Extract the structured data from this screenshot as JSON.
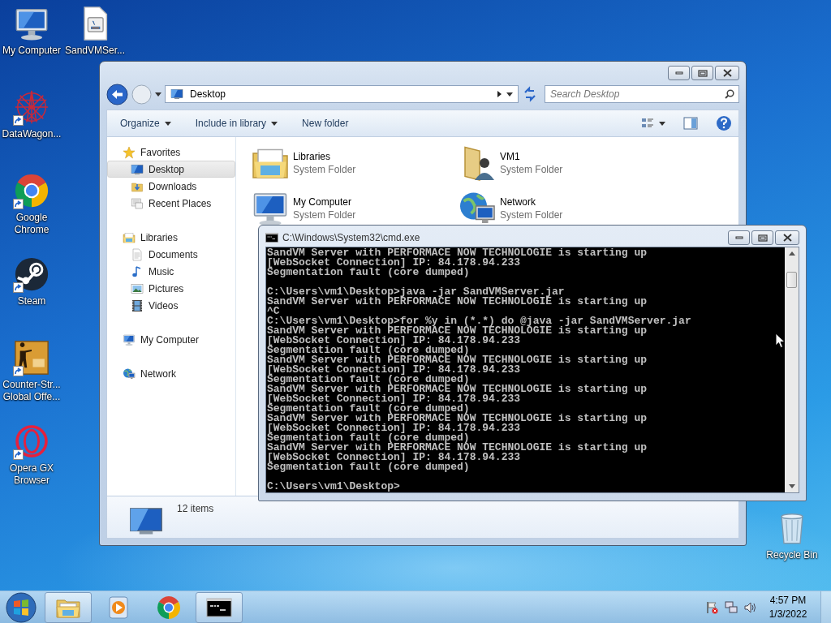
{
  "desktop_icons": [
    {
      "label": "My Computer",
      "kind": "computer",
      "shortcut": false
    },
    {
      "label": "SandVMSer...",
      "kind": "jar",
      "shortcut": false
    },
    {
      "label": "DataWagon...",
      "kind": "web",
      "shortcut": true
    },
    {
      "label": "Google Chrome",
      "kind": "chrome",
      "shortcut": true
    },
    {
      "label": "Steam",
      "kind": "steam",
      "shortcut": true
    },
    {
      "label": "Counter-Str... Global Offe...",
      "kind": "game",
      "shortcut": true
    },
    {
      "label": "Opera GX Browser",
      "kind": "opera",
      "shortcut": true
    }
  ],
  "recycle_bin": {
    "label": "Recycle Bin"
  },
  "explorer": {
    "address": "Desktop",
    "search": {
      "placeholder": "Search Desktop"
    },
    "toolbar": [
      {
        "label": "Organize",
        "has_menu": true
      },
      {
        "label": "Include in library",
        "has_menu": true
      },
      {
        "label": "New folder",
        "has_menu": false
      }
    ],
    "nav": [
      {
        "label": "Favorites",
        "kind": "star",
        "selected": false,
        "children": [
          {
            "label": "Desktop",
            "kind": "desktop",
            "selected": true
          },
          {
            "label": "Downloads",
            "kind": "downloads",
            "selected": false
          },
          {
            "label": "Recent Places",
            "kind": "recent",
            "selected": false
          }
        ]
      },
      {
        "label": "Libraries",
        "kind": "libraries",
        "selected": false,
        "children": [
          {
            "label": "Documents",
            "kind": "documents",
            "selected": false
          },
          {
            "label": "Music",
            "kind": "music",
            "selected": false
          },
          {
            "label": "Pictures",
            "kind": "pictures",
            "selected": false
          },
          {
            "label": "Videos",
            "kind": "videos",
            "selected": false
          }
        ]
      },
      {
        "label": "My Computer",
        "kind": "computer",
        "selected": false
      },
      {
        "label": "Network",
        "kind": "network",
        "selected": false
      }
    ],
    "items": [
      {
        "name": "Libraries",
        "type": "System Folder",
        "kind": "libraries"
      },
      {
        "name": "VM1",
        "type": "System Folder",
        "kind": "user"
      },
      {
        "name": "My Computer",
        "type": "System Folder",
        "kind": "computer"
      },
      {
        "name": "Network",
        "type": "System Folder",
        "kind": "network"
      }
    ],
    "status": "12 items"
  },
  "console": {
    "title": "C:\\Windows\\System32\\cmd.exe",
    "blocks": [
      [
        "SandVM Server with PERFORMACE NOW TECHNOLOGIE is starting up",
        "[WebSocket Connection] IP: 84.178.94.233",
        "Segmentation fault (core dumped)"
      ],
      [
        "C:\\Users\\vm1\\Desktop>java -jar SandVMServer.jar",
        "SandVM Server with PERFORMACE NOW TECHNOLOGIE is starting up",
        "^C",
        "C:\\Users\\vm1\\Desktop>for %y in (*.*) do @java -jar SandVMServer.jar",
        "SandVM Server with PERFORMACE NOW TECHNOLOGIE is starting up",
        "[WebSocket Connection] IP: 84.178.94.233",
        "Segmentation fault (core dumped)",
        "SandVM Server with PERFORMACE NOW TECHNOLOGIE is starting up",
        "[WebSocket Connection] IP: 84.178.94.233",
        "Segmentation fault (core dumped)",
        "SandVM Server with PERFORMACE NOW TECHNOLOGIE is starting up",
        "[WebSocket Connection] IP: 84.178.94.233",
        "Segmentation fault (core dumped)",
        "SandVM Server with PERFORMACE NOW TECHNOLOGIE is starting up",
        "[WebSocket Connection] IP: 84.178.94.233",
        "Segmentation fault (core dumped)",
        "SandVM Server with PERFORMACE NOW TECHNOLOGIE is starting up",
        "[WebSocket Connection] IP: 84.178.94.233",
        "Segmentation fault (core dumped)"
      ],
      [
        "C:\\Users\\vm1\\Desktop>"
      ]
    ]
  },
  "taskbar": {
    "apps": [
      {
        "kind": "explorer",
        "active": true
      },
      {
        "kind": "media",
        "active": false
      },
      {
        "kind": "chrome",
        "active": false
      },
      {
        "kind": "console",
        "active": true
      }
    ],
    "time": "4:57 PM",
    "date": "1/3/2022"
  }
}
